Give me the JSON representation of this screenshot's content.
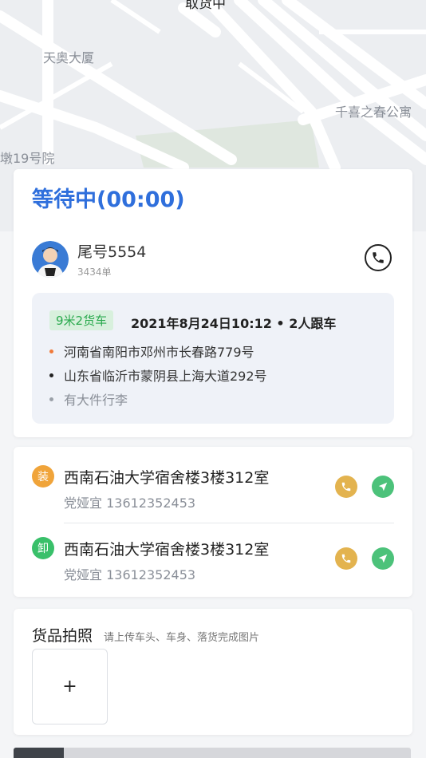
{
  "map": {
    "labels": [
      "天奥大厦",
      "千喜之春公寓",
      "墩19号院"
    ],
    "top_title": "取货中"
  },
  "status_card": {
    "status": "等待中(00:00)",
    "driver_name": "尾号5554",
    "driver_orders": "3434单",
    "order": {
      "vehicle_tag": "9米2货车",
      "time_info": "2021年8月24日10:12 • 2人跟车",
      "lines": [
        "河南省南阳市邓州市长春路779号",
        "山东省临沂市蒙阴县上海大道292号",
        "有大件行李"
      ]
    }
  },
  "address_card": {
    "load": {
      "badge": "装",
      "title": "西南石油大学宿舍楼3楼312室",
      "contact": "党娅宜 13612352453"
    },
    "unload": {
      "badge": "卸",
      "title": "西南石油大学宿舍楼3楼312室",
      "contact": "党娅宜 13612352453"
    }
  },
  "photo_card": {
    "title": "货品拍照",
    "hint": "请上传车头、车身、落货完成图片",
    "upload_symbol": "+"
  },
  "colors": {
    "accent_blue": "#2f6fdc",
    "tag_green": "#29a94d",
    "load_orange": "#f0a43a",
    "unload_green": "#39c06a",
    "phone_yellow": "#e3b34f",
    "nav_green": "#4cc27a"
  },
  "icons": [
    "phone-icon",
    "navigate-icon",
    "plus-icon",
    "avatar-image"
  ]
}
